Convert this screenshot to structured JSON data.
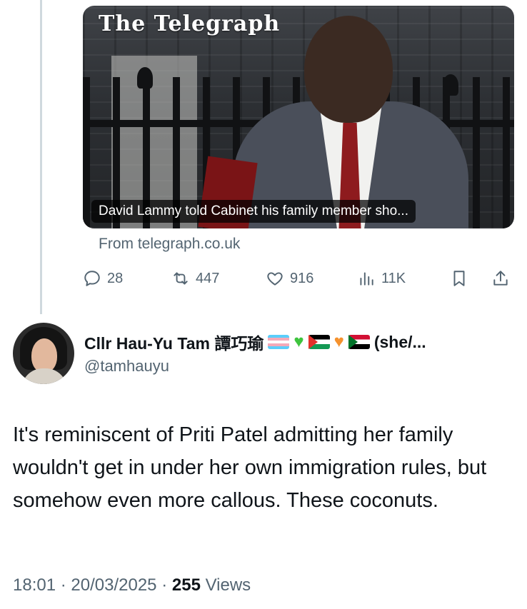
{
  "link_card": {
    "masthead": "The Telegraph",
    "caption": "David Lammy told Cabinet his family member sho...",
    "source": "From telegraph.co.uk"
  },
  "actions": {
    "replies": "28",
    "reposts": "447",
    "likes": "916",
    "views": "11K"
  },
  "reply": {
    "display_name": "Cllr Hau-Yu Tam 譚巧瑜",
    "name_suffix": "(she/...",
    "handle": "@tamhauyu",
    "emoji": [
      "transgender-flag",
      "green-heart",
      "palestine-flag",
      "orange-heart",
      "sudan-flag"
    ],
    "text": "It's reminiscent of Priti Patel admitting her family wouldn't get in under her own immigration rules, but somehow even more callous. These coconuts.",
    "time": "18:01",
    "date": "20/03/2025",
    "views_count": "255",
    "views_label": "Views"
  },
  "colors": {
    "secondary_text": "#536471",
    "primary_text": "#0f1419",
    "thread_line": "#cfd9de"
  }
}
